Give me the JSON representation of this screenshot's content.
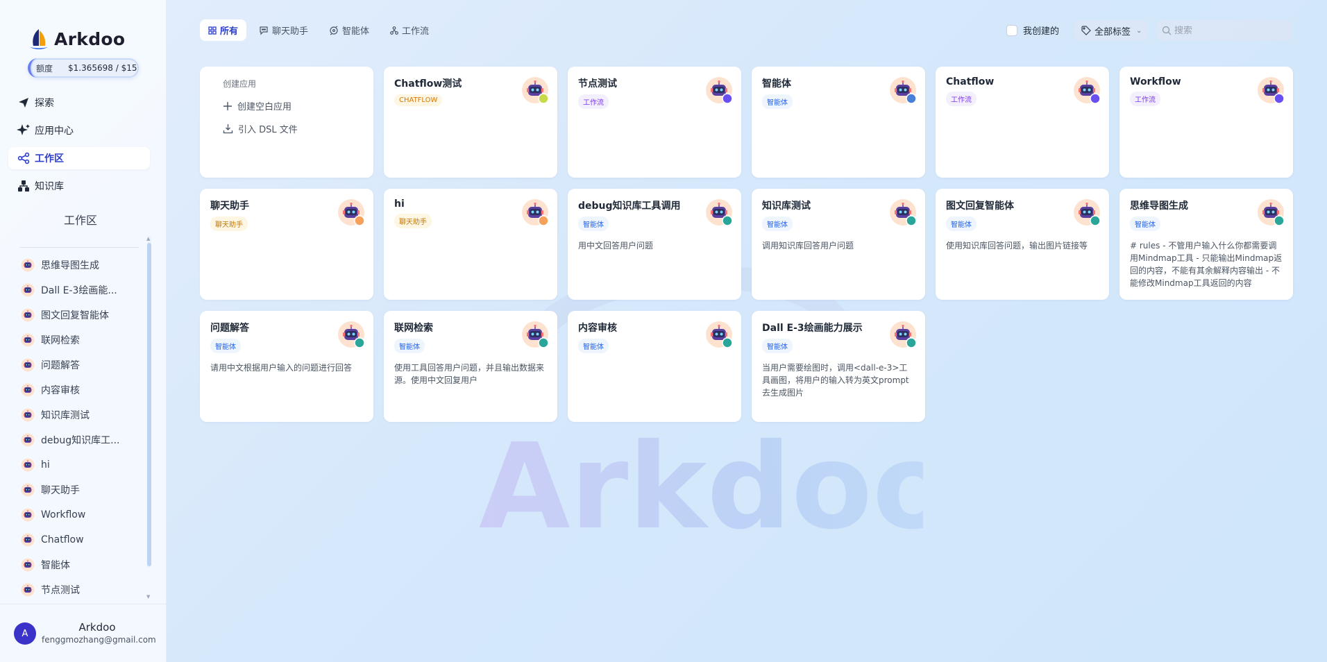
{
  "brand": {
    "name": "Arkdoo",
    "logo_icon": "sail-logo-icon"
  },
  "quota": {
    "label": "额度",
    "value": "$1.365698 / $15"
  },
  "nav": [
    {
      "label": "探索",
      "icon": "send-icon",
      "active": false
    },
    {
      "label": "应用中心",
      "icon": "sparkle-icon",
      "active": false
    },
    {
      "label": "工作区",
      "icon": "workflow-icon",
      "active": true
    },
    {
      "label": "知识库",
      "icon": "knowledge-icon",
      "active": false
    }
  ],
  "workspace": {
    "title": "工作区",
    "items": [
      "思维导图生成",
      "Dall E-3绘画能...",
      "图文回复智能体",
      "联网检索",
      "问题解答",
      "内容审核",
      "知识库测试",
      "debug知识库工...",
      "hi",
      "聊天助手",
      "Workflow",
      "Chatflow",
      "智能体",
      "节点测试"
    ]
  },
  "user": {
    "initial": "A",
    "name": "Arkdoo",
    "email": "fenggmozhang@gmail.com"
  },
  "filters": {
    "tabs": [
      {
        "label": "所有",
        "icon": "grid-icon",
        "active": true
      },
      {
        "label": "聊天助手",
        "icon": "chat-bubble-icon",
        "active": false
      },
      {
        "label": "智能体",
        "icon": "agent-icon",
        "active": false
      },
      {
        "label": "工作流",
        "icon": "workflow-icon",
        "active": false
      }
    ],
    "mine_label": "我创建的",
    "tag_label": "全部标签",
    "search_placeholder": "搜索"
  },
  "create": {
    "title": "创建应用",
    "blank_label": "创建空白应用",
    "dsl_label": "引入 DSL 文件"
  },
  "apps": [
    {
      "title": "Chatflow测试",
      "badge": "CHATFLOW",
      "type": "chatflow",
      "desc": "",
      "dot": "#c8d94a"
    },
    {
      "title": "节点测试",
      "badge": "工作流",
      "type": "workflow",
      "desc": "",
      "dot": "#6a4ff0"
    },
    {
      "title": "智能体",
      "badge": "智能体",
      "type": "agent",
      "desc": "",
      "dot": "#4a7fd8"
    },
    {
      "title": "Chatflow",
      "badge": "工作流",
      "type": "workflow",
      "desc": "",
      "dot": "#6a4ff0"
    },
    {
      "title": "Workflow",
      "badge": "工作流",
      "type": "workflow",
      "desc": "",
      "dot": "#6a4ff0"
    },
    {
      "title": "聊天助手",
      "badge": "聊天助手",
      "type": "chat",
      "desc": "",
      "dot": "#f6a15b"
    },
    {
      "title": "hi",
      "badge": "聊天助手",
      "type": "chat",
      "desc": "",
      "dot": "#f6a15b"
    },
    {
      "title": "debug知识库工具调用",
      "badge": "智能体",
      "type": "agent",
      "desc": "用中文回答用户问题",
      "dot": "#2aa59a"
    },
    {
      "title": "知识库测试",
      "badge": "智能体",
      "type": "agent",
      "desc": "调用知识库回答用户问题",
      "dot": "#2aa59a"
    },
    {
      "title": "图文回复智能体",
      "badge": "智能体",
      "type": "agent",
      "desc": "使用知识库回答问题，输出图片链接等",
      "dot": "#2aa59a"
    },
    {
      "title": "思维导图生成",
      "badge": "智能体",
      "type": "agent",
      "desc": "# rules - 不管用户输入什么你都需要调用Mindmap工具 - 只能输出Mindmap返回的内容，不能有其余解释内容输出 - 不能修改Mindmap工具返回的内容",
      "dot": "#2aa59a"
    },
    {
      "title": "问题解答",
      "badge": "智能体",
      "type": "agent",
      "desc": "请用中文根据用户输入的问题进行回答",
      "dot": "#2aa59a"
    },
    {
      "title": "联网检索",
      "badge": "智能体",
      "type": "agent",
      "desc": "使用工具回答用户问题，并且输出数据来源。使用中文回复用户",
      "dot": "#2aa59a"
    },
    {
      "title": "内容审核",
      "badge": "智能体",
      "type": "agent",
      "desc": "",
      "dot": "#2aa59a"
    },
    {
      "title": "Dall E-3绘画能力展示",
      "badge": "智能体",
      "type": "agent",
      "desc": "当用户需要绘图时，调用<dall-e-3>工具画图，将用户的输入转为英文prompt去生成图片",
      "dot": "#2aa59a"
    }
  ],
  "watermark": {
    "text": "Arkdoo"
  }
}
